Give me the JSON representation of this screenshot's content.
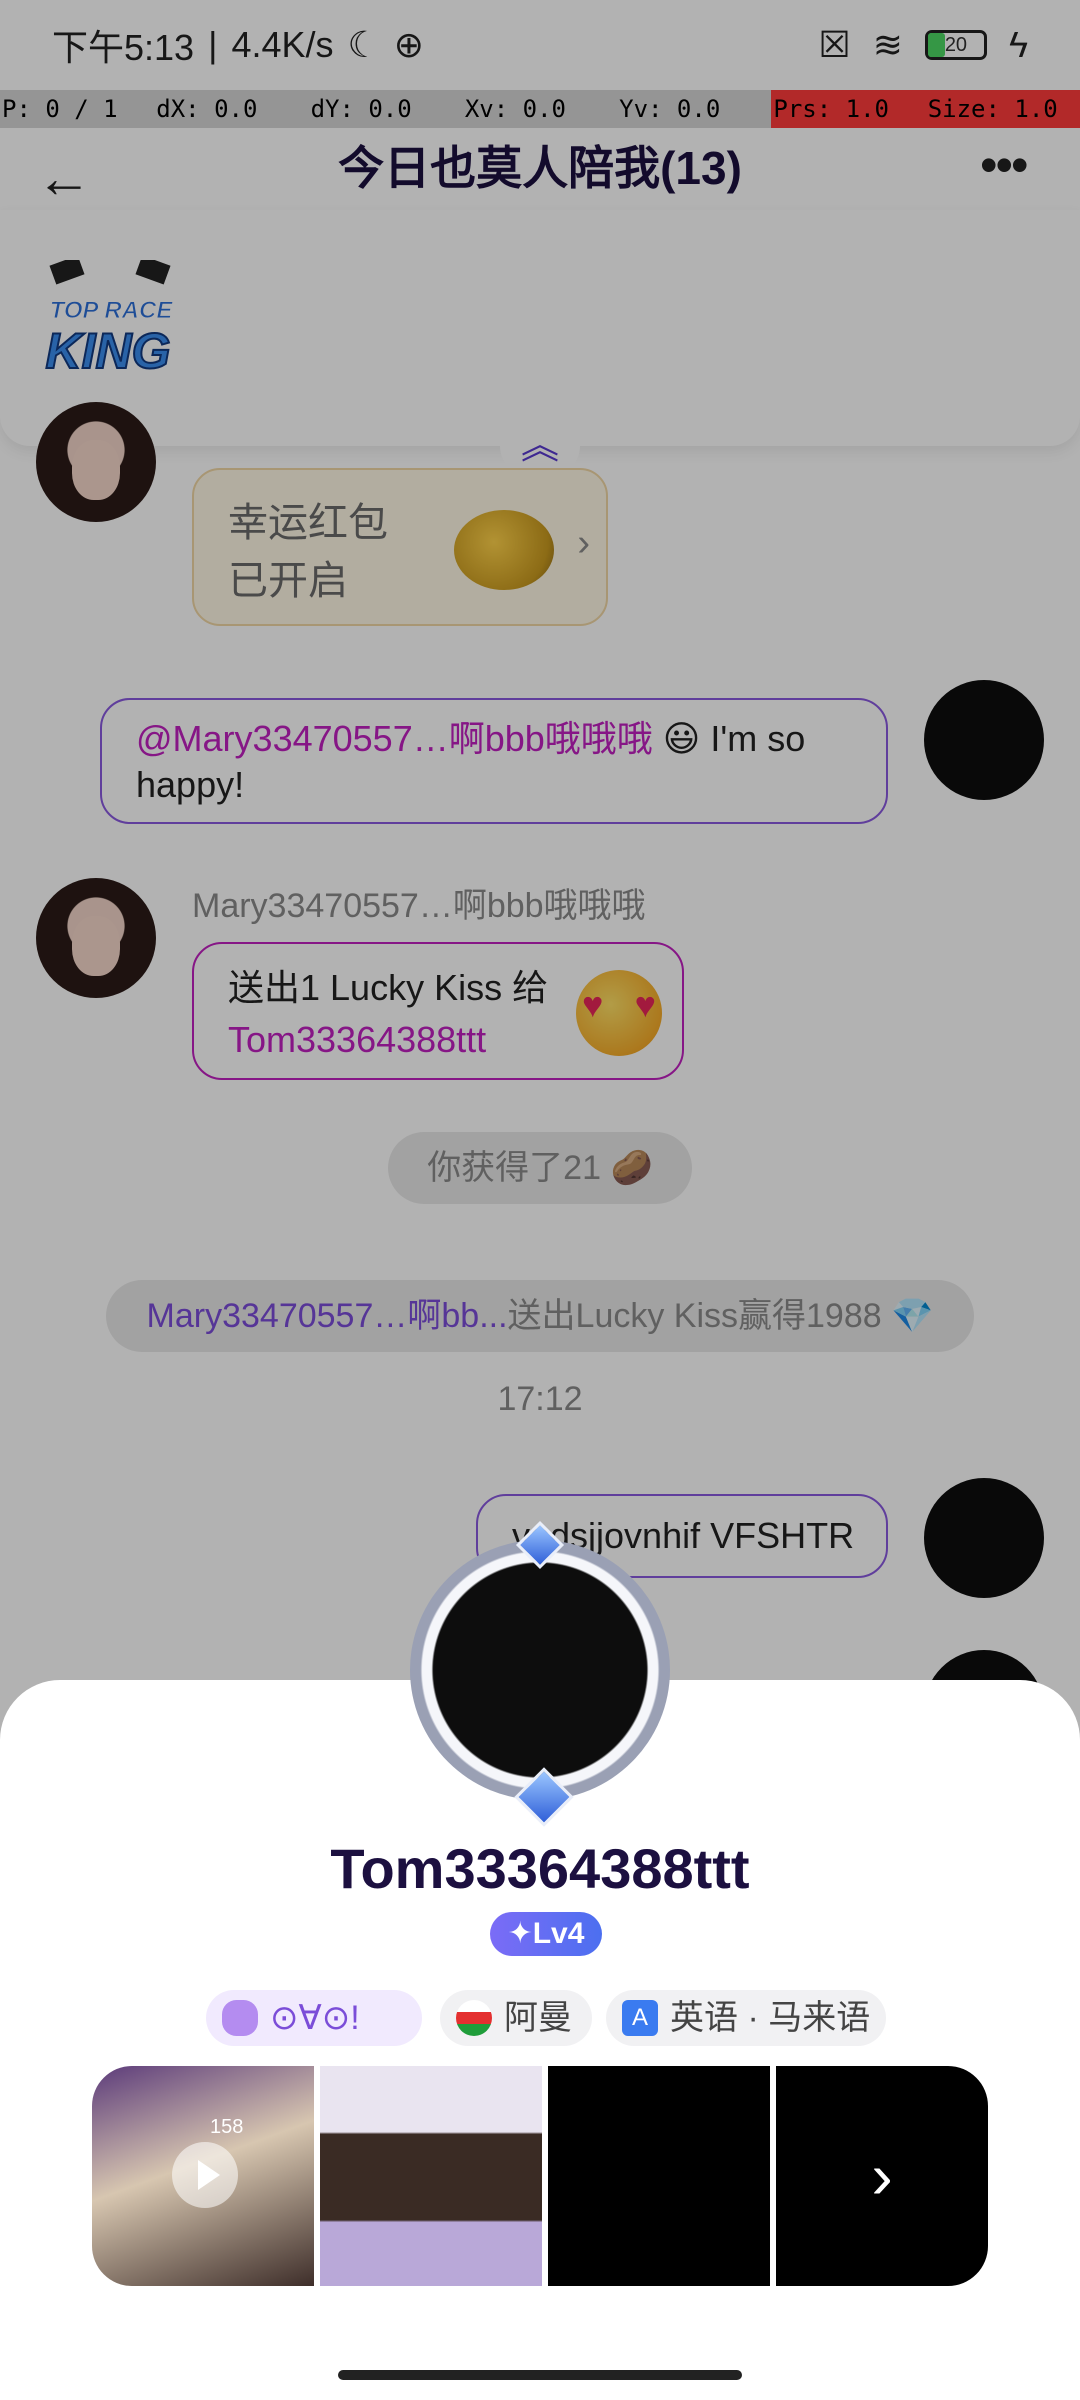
{
  "status_bar": {
    "time": "下午5:13",
    "net_speed": "4.4K/s",
    "battery": "20"
  },
  "debug": {
    "p": "P: 0 / 1",
    "dx": "dX: 0.0",
    "dy": "dY: 0.0",
    "xv": "Xv: 0.0",
    "yv": "Yv: 0.0",
    "prs": "Prs: 1.0",
    "size": "Size: 1.0"
  },
  "header": {
    "title": "今日也莫人陪我(13)",
    "back_icon": "arrow-left-icon",
    "more_icon": "more-dots-icon"
  },
  "game_panel": {
    "logo_line1": "TOP RACE",
    "logo_line2": "KING",
    "collapse_icon": "double-chevron-up-icon"
  },
  "messages": {
    "red_packet_line1": "幸运红包",
    "red_packet_line2": "已开启",
    "mine_mention": "@Mary33470557…啊bbb哦哦哦",
    "mine_text": "😃 I'm so happy!",
    "sender_name": "Mary33470557…啊bbb哦哦哦",
    "gift_line1": "送出1 Lucky Kiss 给",
    "gift_line2": "Tom33364388ttt",
    "reward_notice": "你获得了21 🥔",
    "lucky_notice_name": "Mary33470557…啊bb...",
    "lucky_notice_text": "送出Lucky Kiss赢得1988 💎",
    "time": "17:12",
    "last_message": "vgdsjjovnhif VFSHTR"
  },
  "profile": {
    "username": "Tom33364388ttt",
    "level": "Lv4",
    "tags": {
      "mood": "⊙∀⊙!",
      "country": "阿曼",
      "languages": "英语 · 马来语"
    },
    "gallery": {
      "live_views": "158",
      "more_icon": "chevron-right-icon"
    }
  }
}
